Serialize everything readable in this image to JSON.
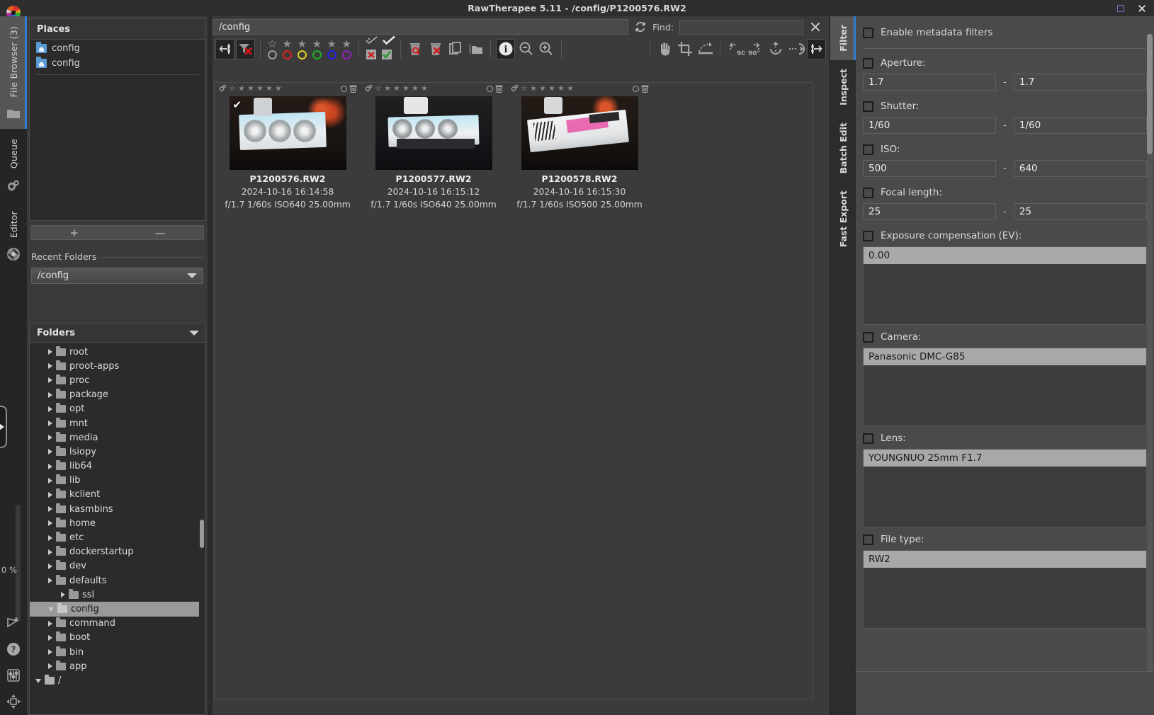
{
  "window": {
    "title": "RawTherapee 5.11 - /config/P1200576.RW2",
    "maximize_icon": "maximize-icon",
    "close_icon": "close-icon"
  },
  "left_rail": {
    "tabs": [
      {
        "label": "File Browser (3)",
        "icon": "folder-icon",
        "active": true
      },
      {
        "label": "Queue",
        "icon": "gears-icon",
        "active": false
      },
      {
        "label": "Editor",
        "icon": "aperture-icon",
        "active": false
      }
    ],
    "progress_label": "0 %",
    "bottom_icons": [
      "send-icon",
      "help-icon",
      "preferences-sliders-icon",
      "move-icon"
    ]
  },
  "places": {
    "title": "Places",
    "items": [
      {
        "label": "config",
        "icon": "home-folder-icon"
      },
      {
        "label": "config",
        "icon": "home-folder-icon"
      }
    ],
    "add_label": "+",
    "remove_label": "—"
  },
  "recent_folders": {
    "legend": "Recent Folders",
    "selected": "/config"
  },
  "folders": {
    "legend": "Folders",
    "tree": [
      {
        "label": "/",
        "depth": 0,
        "expander": "down",
        "icon": "folder-open-icon",
        "selected": false
      },
      {
        "label": "app",
        "depth": 1,
        "expander": "right",
        "icon": "folder-icon",
        "selected": false
      },
      {
        "label": "bin",
        "depth": 1,
        "expander": "right",
        "icon": "folder-icon",
        "selected": false
      },
      {
        "label": "boot",
        "depth": 1,
        "expander": "right",
        "icon": "folder-icon",
        "selected": false
      },
      {
        "label": "command",
        "depth": 1,
        "expander": "right",
        "icon": "folder-icon",
        "selected": false
      },
      {
        "label": "config",
        "depth": 1,
        "expander": "down",
        "icon": "folder-open-icon",
        "selected": true
      },
      {
        "label": "ssl",
        "depth": 2,
        "expander": "right",
        "icon": "folder-icon",
        "selected": false
      },
      {
        "label": "defaults",
        "depth": 1,
        "expander": "right",
        "icon": "folder-icon",
        "selected": false
      },
      {
        "label": "dev",
        "depth": 1,
        "expander": "right",
        "icon": "folder-icon",
        "selected": false
      },
      {
        "label": "dockerstartup",
        "depth": 1,
        "expander": "right",
        "icon": "folder-icon",
        "selected": false
      },
      {
        "label": "etc",
        "depth": 1,
        "expander": "right",
        "icon": "folder-icon",
        "selected": false
      },
      {
        "label": "home",
        "depth": 1,
        "expander": "right",
        "icon": "folder-icon",
        "selected": false
      },
      {
        "label": "kasmbins",
        "depth": 1,
        "expander": "right",
        "icon": "folder-icon",
        "selected": false
      },
      {
        "label": "kclient",
        "depth": 1,
        "expander": "right",
        "icon": "folder-icon",
        "selected": false
      },
      {
        "label": "lib",
        "depth": 1,
        "expander": "right",
        "icon": "folder-icon",
        "selected": false
      },
      {
        "label": "lib64",
        "depth": 1,
        "expander": "right",
        "icon": "folder-icon",
        "selected": false
      },
      {
        "label": "lsiopy",
        "depth": 1,
        "expander": "right",
        "icon": "folder-icon",
        "selected": false
      },
      {
        "label": "media",
        "depth": 1,
        "expander": "right",
        "icon": "folder-icon",
        "selected": false
      },
      {
        "label": "mnt",
        "depth": 1,
        "expander": "right",
        "icon": "folder-icon",
        "selected": false
      },
      {
        "label": "opt",
        "depth": 1,
        "expander": "right",
        "icon": "folder-icon",
        "selected": false
      },
      {
        "label": "package",
        "depth": 1,
        "expander": "right",
        "icon": "folder-icon",
        "selected": false
      },
      {
        "label": "proc",
        "depth": 1,
        "expander": "right",
        "icon": "folder-icon",
        "selected": false
      },
      {
        "label": "proot-apps",
        "depth": 1,
        "expander": "right",
        "icon": "folder-icon",
        "selected": false
      },
      {
        "label": "root",
        "depth": 1,
        "expander": "right",
        "icon": "folder-icon",
        "selected": false
      }
    ]
  },
  "browser": {
    "path_value": "/config",
    "refresh_icon": "refresh-icon",
    "find_label": "Find:",
    "find_value": "",
    "find_clear_icon": "clear-icon",
    "toolbar": {
      "buttons": [
        {
          "name": "toggle-left-panel-button",
          "icon": "panel-left-icon",
          "active": true
        },
        {
          "name": "clear-filters-button",
          "icon": "funnel-x-icon",
          "active": true
        },
        {
          "name": "filter-unrated-button",
          "icon": "star-outline-icon"
        },
        {
          "name": "filter-rank1-button",
          "icon": "star-icon"
        },
        {
          "name": "filter-rank2-button",
          "icon": "star-icon"
        },
        {
          "name": "filter-rank3-button",
          "icon": "star-icon"
        },
        {
          "name": "filter-rank4-button",
          "icon": "star-icon"
        },
        {
          "name": "filter-rank5-button",
          "icon": "star-icon"
        },
        {
          "name": "color-label-none-button",
          "icon": "circle-grey-icon",
          "color": "#9a9a9a"
        },
        {
          "name": "color-label-red-button",
          "icon": "circle-red-icon",
          "color": "#e02020"
        },
        {
          "name": "color-label-yellow-button",
          "icon": "circle-yellow-icon",
          "color": "#e0d020"
        },
        {
          "name": "color-label-green-button",
          "icon": "circle-green-icon",
          "color": "#20b020"
        },
        {
          "name": "color-label-blue-button",
          "icon": "circle-blue-icon",
          "color": "#2020e0"
        },
        {
          "name": "color-label-purple-button",
          "icon": "circle-purple-icon",
          "color": "#9020c0"
        },
        {
          "name": "filter-unedited-button",
          "icon": "check-outline-icon"
        },
        {
          "name": "filter-edited-button",
          "icon": "check-icon"
        },
        {
          "name": "filter-not-saved-button",
          "icon": "save-x-icon"
        },
        {
          "name": "filter-saved-button",
          "icon": "save-check-icon"
        },
        {
          "name": "trash-inspect-button",
          "icon": "trash-search-icon"
        },
        {
          "name": "empty-trash-button",
          "icon": "trash-x-icon"
        },
        {
          "name": "copy-profile-button",
          "icon": "copy-icon"
        },
        {
          "name": "open-folder-button",
          "icon": "open-folder-icon"
        },
        {
          "name": "toggle-info-button",
          "icon": "info-icon",
          "active": true
        },
        {
          "name": "zoom-out-button",
          "icon": "zoom-out-icon"
        },
        {
          "name": "zoom-in-button",
          "icon": "zoom-in-icon"
        },
        {
          "name": "hand-tool-button",
          "icon": "hand-icon"
        },
        {
          "name": "crop-tool-button",
          "icon": "crop-icon"
        },
        {
          "name": "straighten-tool-button",
          "icon": "straighten-icon"
        },
        {
          "name": "rotate-left-button",
          "icon": "rotate-left-90-icon"
        },
        {
          "name": "rotate-right-button",
          "icon": "rotate-right-90-icon"
        },
        {
          "name": "flip-vertical-button",
          "icon": "flip-vertical-icon"
        },
        {
          "name": "flip-horizontal-button",
          "icon": "flip-horizontal-icon"
        },
        {
          "name": "toggle-right-panel-button",
          "icon": "panel-right-icon",
          "active": true
        }
      ]
    },
    "thumbnails": [
      {
        "name": "P1200576.RW2",
        "date": "2024-10-16 16:14:58",
        "exif": "f/1.7 1/60s ISO640 25.00mm",
        "has_check": true,
        "rating_stars": 5,
        "image_alt": "white-gpu-front-view"
      },
      {
        "name": "P1200577.RW2",
        "date": "2024-10-16 16:15:12",
        "exif": "f/1.7 1/60s ISO640 25.00mm",
        "has_check": false,
        "rating_stars": 5,
        "image_alt": "white-gpu-side-view"
      },
      {
        "name": "P1200578.RW2",
        "date": "2024-10-16 16:15:30",
        "exif": "f/1.7 1/60s ISO500 25.00mm",
        "has_check": false,
        "rating_stars": 5,
        "image_alt": "white-gpu-backplate-view"
      }
    ]
  },
  "right_tabs": [
    {
      "label": "Filter",
      "active": true
    },
    {
      "label": "Inspect",
      "active": false
    },
    {
      "label": "Batch Edit",
      "active": false
    },
    {
      "label": "Fast Export",
      "active": false
    }
  ],
  "filter_panel": {
    "enable_label": "Enable metadata filters",
    "enable_checked": false,
    "fields": [
      {
        "label": "Aperture:",
        "checked": false,
        "min": "1.7",
        "max": "1.7",
        "separator": "-"
      },
      {
        "label": "Shutter:",
        "checked": false,
        "min": "1/60",
        "max": "1/60",
        "separator": "-"
      },
      {
        "label": "ISO:",
        "checked": false,
        "min": "500",
        "max": "640",
        "separator": "-"
      },
      {
        "label": "Focal length:",
        "checked": false,
        "min": "25",
        "max": "25",
        "separator": "-"
      }
    ],
    "lists": [
      {
        "label": "Exposure compensation (EV):",
        "checked": false,
        "selected": "0.00"
      },
      {
        "label": "Camera:",
        "checked": false,
        "selected": "Panasonic DMC-G85"
      },
      {
        "label": "Lens:",
        "checked": false,
        "selected": "YOUNGNUO 25mm F1.7"
      },
      {
        "label": "File type:",
        "checked": false,
        "selected": "RW2"
      }
    ]
  },
  "colors": {
    "accent": "#2f7fd1",
    "panel_bg": "#4a4a4a",
    "window_bg": "#3b3b3b",
    "selected_row": "#9a9a9a"
  }
}
